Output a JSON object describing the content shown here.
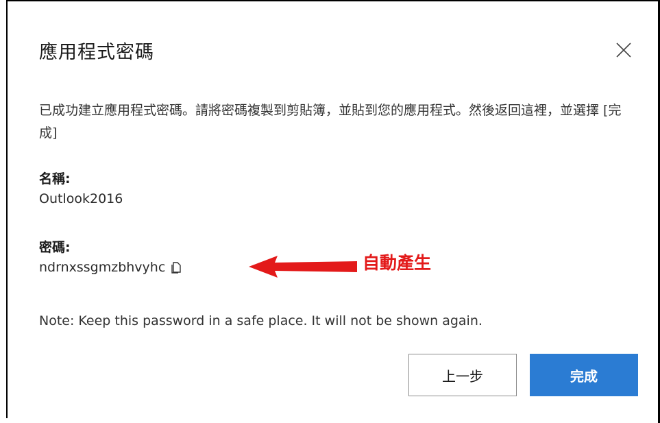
{
  "dialog": {
    "title": "應用程式密碼",
    "description": "已成功建立應用程式密碼。請將密碼複製到剪貼簿，並貼到您的應用程式。然後返回這裡，並選擇 [完成]",
    "name_label": "名稱:",
    "name_value": "Outlook2016",
    "password_label": "密碼:",
    "password_value": "ndrnxssgmzbhvyhc",
    "note": "Note: Keep this password in a safe place. It will not be shown again.",
    "back_label": "上一步",
    "done_label": "完成",
    "close_icon": "close-icon",
    "copy_icon": "copy-icon"
  },
  "annotation": {
    "text": "自動產生",
    "color": "#e31a1a"
  },
  "colors": {
    "primary": "#2b7cd3",
    "text": "#1b1b1b"
  }
}
